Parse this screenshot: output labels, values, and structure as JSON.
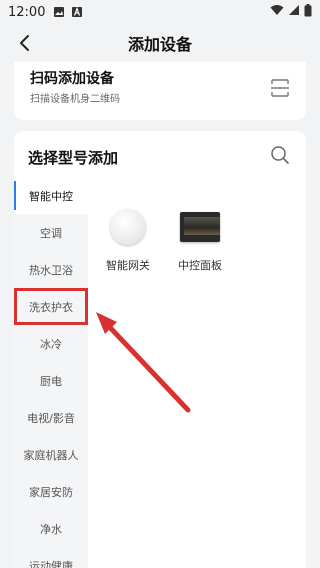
{
  "status_bar": {
    "time": "12:00"
  },
  "header": {
    "title": "添加设备"
  },
  "scan": {
    "title": "扫码添加设备",
    "subtitle": "扫描设备机身二维码",
    "icon": "scan-icon"
  },
  "model": {
    "title": "选择型号添加",
    "search_icon": "search-icon",
    "categories": [
      {
        "label": "智能中控"
      },
      {
        "label": "空调"
      },
      {
        "label": "热水卫浴"
      },
      {
        "label": "洗衣护衣"
      },
      {
        "label": "冰冷"
      },
      {
        "label": "厨电"
      },
      {
        "label": "电视/影音"
      },
      {
        "label": "家庭机器人"
      },
      {
        "label": "家居安防"
      },
      {
        "label": "净水"
      },
      {
        "label": "运动健康"
      }
    ],
    "products": [
      {
        "name": "智能网关"
      },
      {
        "name": "中控面板"
      }
    ]
  },
  "colors": {
    "accent": "#2b7de9",
    "annotation": "#d93030",
    "background": "#f2f3f5"
  }
}
